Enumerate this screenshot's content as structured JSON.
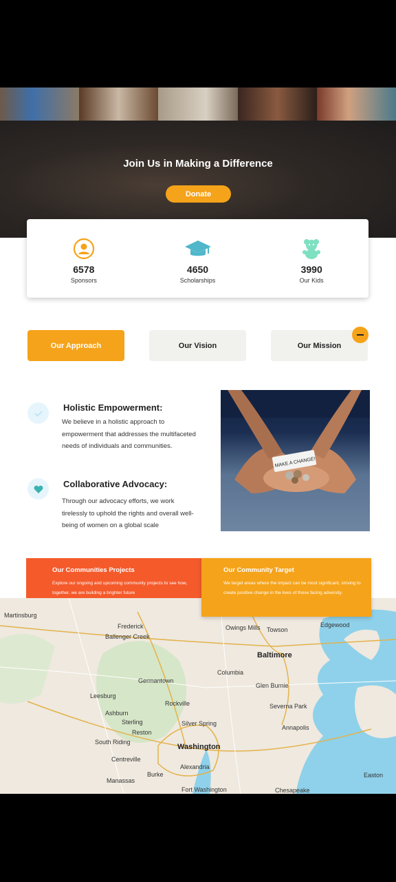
{
  "hero": {
    "title": "Join Us in Making a Difference",
    "donate_label": "Donate"
  },
  "stats": [
    {
      "icon": "person-icon",
      "value": "6578",
      "label": "Sponsors",
      "color": "#f5a31a"
    },
    {
      "icon": "graduation-cap-icon",
      "value": "4650",
      "label": "Scholarships",
      "color": "#4fb7c9"
    },
    {
      "icon": "teddy-bear-icon",
      "value": "3990",
      "label": "Our Kids",
      "color": "#7ee0c0"
    }
  ],
  "tabs": [
    {
      "label": "Our Approach",
      "active": true
    },
    {
      "label": "Our Vision",
      "active": false
    },
    {
      "label": "Our Mission",
      "active": false
    }
  ],
  "features": [
    {
      "icon": "checkmark-icon",
      "title": "Holistic Empowerment:",
      "text": "We believe in a holistic approach to empowerment that addresses the multifaceted needs of individuals and communities."
    },
    {
      "icon": "heart-icon",
      "title": "Collaborative Advocacy:",
      "text": "Through our advocacy efforts, we work tirelessly to uphold the rights and overall well-being of women on a global scale"
    }
  ],
  "photo": {
    "note_text": "MAKE A CHANGE!"
  },
  "banners": [
    {
      "title": "Our Communities Projects",
      "text": "Explore our ongoing and upcoming community projects to see how, together, we are building a brighter future",
      "color": "#f55a2b"
    },
    {
      "title": "Our Community Target",
      "text": "We target areas where the impact can be most significant, striving to create positive change in the lives of those facing adversity.",
      "color": "#f5a31a"
    }
  ],
  "map": {
    "labels": [
      "Martinsburg",
      "Frederick",
      "Ballenger Creek",
      "Owings Mills",
      "Towson",
      "Edgewood",
      "Baltimore",
      "Columbia",
      "Germantown",
      "Glen Burnie",
      "Leesburg",
      "Rockville",
      "Severna Park",
      "Ashburn",
      "Sterling",
      "Silver Spring",
      "Annapolis",
      "Reston",
      "South Riding",
      "Washington",
      "Centreville",
      "Alexandria",
      "Burke",
      "Manassas",
      "Fort Washington",
      "Chesapeake",
      "Easton"
    ],
    "highways": [
      "11",
      "270",
      "81",
      "95",
      "695",
      "50",
      "66",
      "495",
      "97"
    ]
  },
  "colors": {
    "accent": "#f5a31a",
    "orange_red": "#f55a2b",
    "water": "#8fd1ea"
  }
}
